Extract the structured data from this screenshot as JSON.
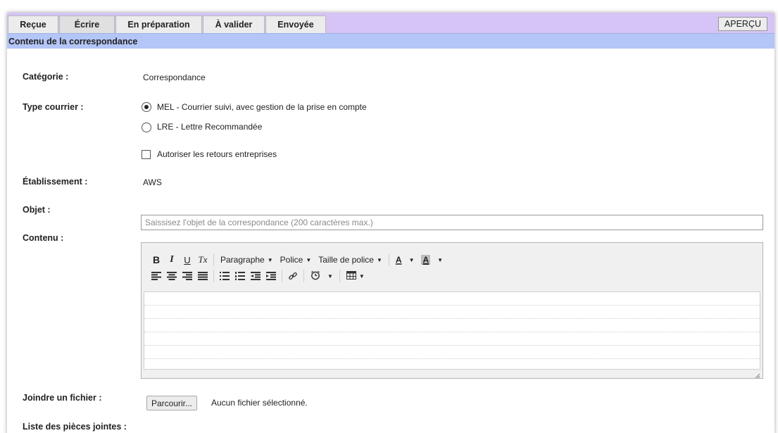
{
  "tabs": [
    {
      "label": "Reçue"
    },
    {
      "label": "Écrire"
    },
    {
      "label": "En préparation"
    },
    {
      "label": "À valider"
    },
    {
      "label": "Envoyée"
    }
  ],
  "active_tab": "Écrire",
  "apercu_label": "APERÇU",
  "section_title": "Contenu de la correspondance",
  "form": {
    "categorie_label": "Catégorie :",
    "categorie_value": "Correspondance",
    "type_label": "Type courrier :",
    "type_options": [
      {
        "label": "MEL - Courrier suivi, avec gestion de la prise en compte",
        "checked": true
      },
      {
        "label": "LRE - Lettre Recommandée",
        "checked": false
      }
    ],
    "autoriser_label": "Autoriser les retours entreprises",
    "autoriser_checked": false,
    "etablissement_label": "Établissement :",
    "etablissement_value": "AWS",
    "objet_label": "Objet :",
    "objet_value": "",
    "objet_placeholder": "Saissisez l'objet de la correspondance (200 caractères max.)",
    "contenu_label": "Contenu :",
    "joindre_label": "Joindre un fichier :",
    "browse_label": "Parcourir...",
    "no_file_text": "Aucun fichier sélectionné.",
    "liste_label": "Liste des pièces jointes :"
  },
  "editor": {
    "bold_label": "B",
    "italic_label": "I",
    "underline_label": "U",
    "clear_format_label": "Tx",
    "paragraph_label": "Paragraphe",
    "font_label": "Police",
    "font_size_label": "Taille de police",
    "text_color_label": "A",
    "bg_color_label": "A"
  },
  "colors": {
    "tabbar_bg": "#d5c4f5",
    "section_header_bg": "#b4c6f7"
  }
}
